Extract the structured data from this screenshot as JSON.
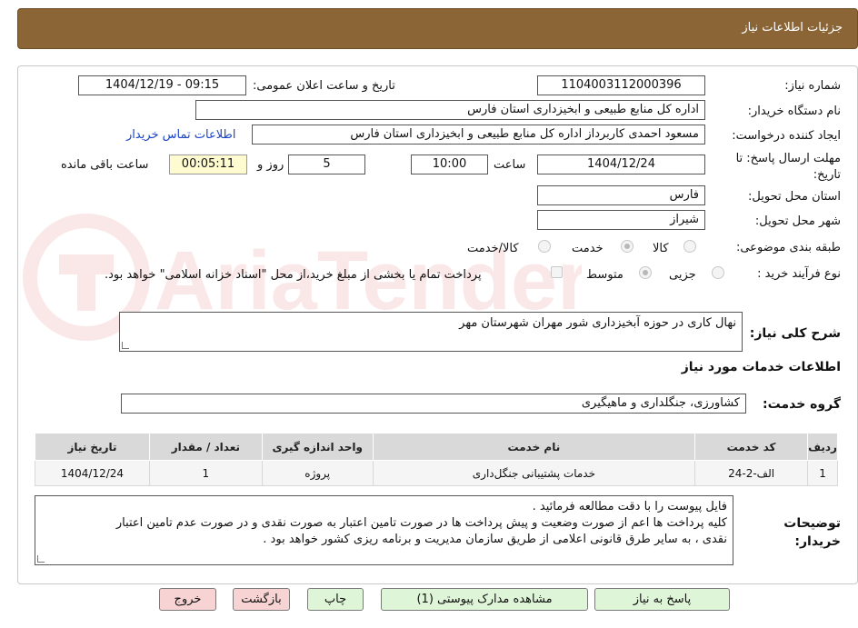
{
  "header": {
    "title": "جزئیات اطلاعات نیاز"
  },
  "watermark": {
    "text": "AriaTender.neT"
  },
  "form": {
    "need_number_label": "شماره نیاز:",
    "need_number": "1104003112000396",
    "announce_label": "تاریخ و ساعت اعلان عمومی:",
    "announce_value": "1404/12/19 - 09:15",
    "buyer_org_label": "نام دستگاه خریدار:",
    "buyer_org": "اداره کل منابع طبیعی و ابخیزداری استان فارس",
    "requester_label": "ایجاد کننده درخواست:",
    "requester": "مسعود احمدی کاربرداز اداره کل منابع طبیعی و ابخیزداری استان فارس",
    "contact_link": "اطلاعات تماس خریدار",
    "deadline_label": "مهلت ارسال پاسخ: تا تاریخ:",
    "deadline_date": "1404/12/24",
    "time_label": "ساعت",
    "deadline_time": "10:00",
    "days_value": "5",
    "days_label": "روز و",
    "remaining_time": "00:05:11",
    "remaining_label": "ساعت باقی مانده",
    "province_label": "استان محل تحویل:",
    "province": "فارس",
    "city_label": "شهر محل تحویل:",
    "city": "شیراز",
    "category_label": "طبقه بندی موضوعی:",
    "category_options": [
      "کالا",
      "خدمت",
      "کالا/خدمت"
    ],
    "process_label": "نوع فرآیند خرید :",
    "process_options": [
      "جزیی",
      "متوسط"
    ],
    "payment_note": "پرداخت تمام یا بخشی از مبلغ خرید،از محل \"اسناد خزانه اسلامی\" خواهد بود.",
    "summary_label": "شرح کلی نیاز:",
    "summary": "نهال کاری در حوزه آبخیزداری شور مهران شهرستان مهر",
    "services_title": "اطلاعات خدمات مورد نیاز",
    "service_group_label": "گروه خدمت:",
    "service_group": "کشاورزی، جنگلداری و ماهیگیری"
  },
  "services_table": {
    "headers": [
      "ردیف",
      "کد خدمت",
      "نام خدمت",
      "واحد اندازه گیری",
      "تعداد / مقدار",
      "تاریخ نیاز"
    ],
    "rows": [
      [
        "1",
        "الف-2-24",
        "خدمات پشتیبانی جنگل‌داری",
        "پروژه",
        "1",
        "1404/12/24"
      ]
    ]
  },
  "buyer_notes": {
    "label": "توضیحات خریدار:",
    "lines": [
      "فایل پیوست را با دقت مطالعه فرمائید .",
      "کلیه پرداخت ها  اعم از صورت وضعیت و پیش پرداخت ها در صورت تامین اعتبار به صورت نقدی و در صورت عدم تامین اعتبار",
      "نقدی ، به سایر طرق قانونی اعلامی از طریق سازمان مدیریت و برنامه ریزی کشور خواهد بود ."
    ]
  },
  "buttons": {
    "reply": "پاسخ به نیاز",
    "attachments": "مشاهده مدارک پیوستی (1)",
    "print": "چاپ",
    "back": "بازگشت",
    "exit": "خروج"
  },
  "colors": {
    "header": "#8b6535",
    "green_button": "#dff5d8",
    "pink_button": "#f8d3d3",
    "link": "#1a44c8"
  }
}
